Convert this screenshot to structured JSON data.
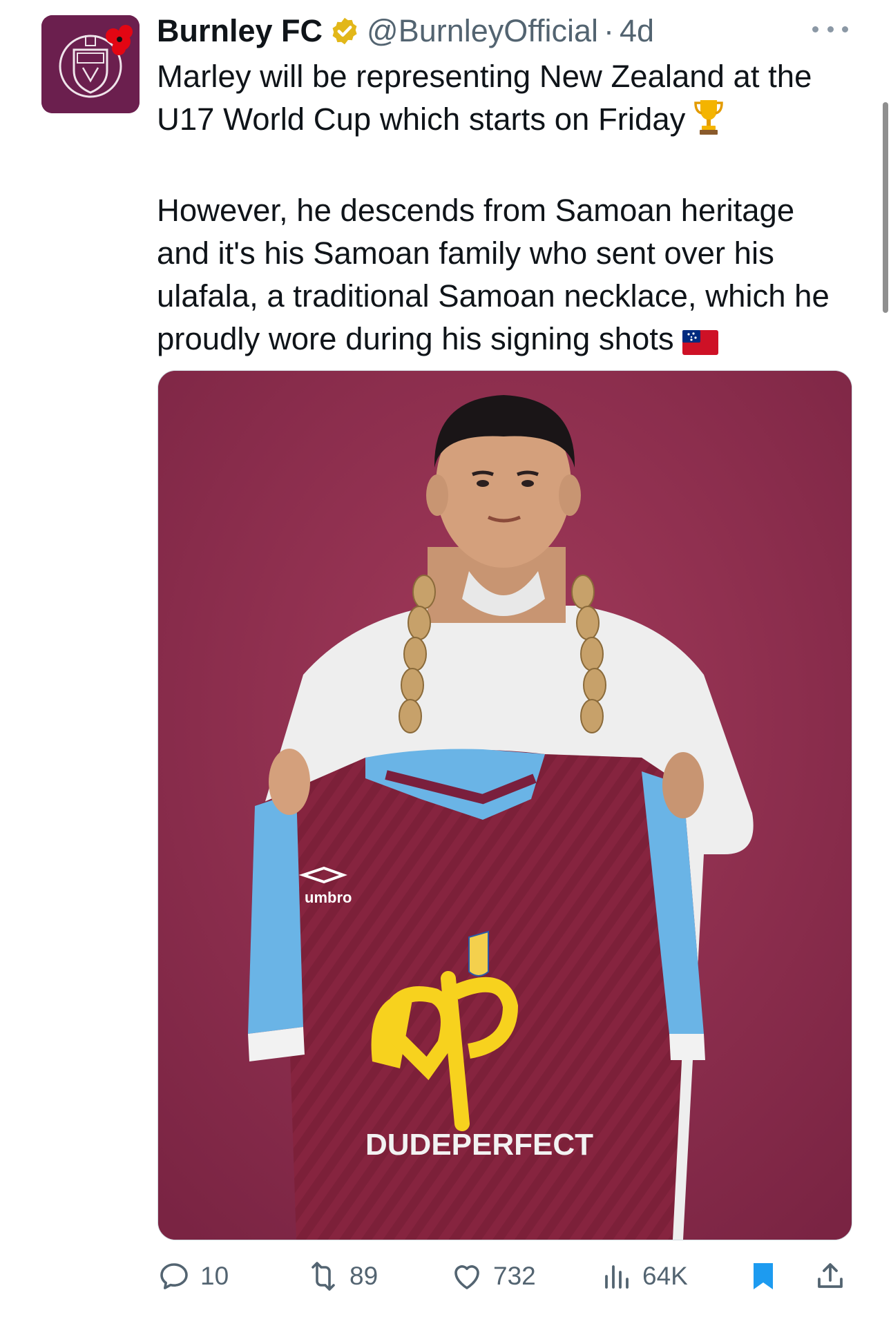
{
  "tweet": {
    "display_name": "Burnley FC",
    "handle": "@BurnleyOfficial",
    "separator": "·",
    "time": "4d",
    "paragraphs": [
      "Marley will be representing New Zealand at the U17 World Cup which starts on Friday",
      "However, he descends from Samoan heritage and it's his Samoan family who sent over his ulafala, a traditional Samoan necklace, which he proudly wore during his signing shots"
    ],
    "paragraph_emojis": [
      "trophy-emoji",
      "samoa-flag-emoji"
    ],
    "media": {
      "shirt_sponsor": "DUDEPERFECT",
      "shirt_brand": "umbro"
    }
  },
  "actions": {
    "replies": "10",
    "reposts": "89",
    "likes": "732",
    "views": "64K"
  },
  "icons": {
    "reply": "reply-icon",
    "repost": "repost-icon",
    "like": "like-icon",
    "views": "views-icon",
    "bookmark": "bookmark-icon",
    "share": "share-icon",
    "more": "more-icon",
    "verified": "verified-badge-icon"
  },
  "colors": {
    "text_primary": "#0f1419",
    "text_secondary": "#536471",
    "verified_gold": "#e2b719",
    "bookmark_blue": "#1d9bf0",
    "claret": "#7a1f3d",
    "sky_blue": "#6ab4e6"
  }
}
